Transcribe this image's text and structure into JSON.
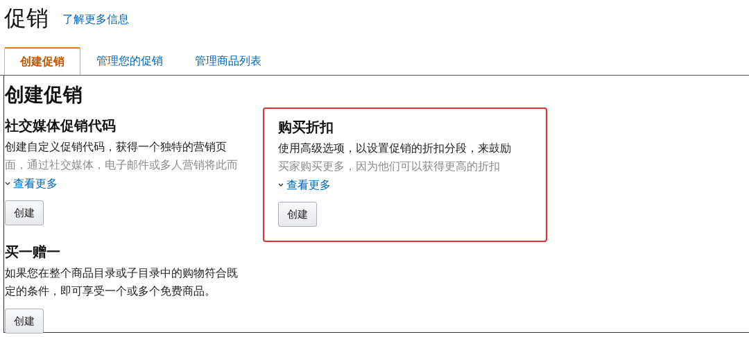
{
  "page": {
    "title": "促销",
    "link": "了解更多信息"
  },
  "tabs": [
    {
      "label": "创建促销",
      "selected": true
    },
    {
      "label": "管理您的促销",
      "selected": false
    },
    {
      "label": "管理商品列表",
      "selected": false
    }
  ],
  "section_title": "创建促销",
  "cards": [
    {
      "title": "社交媒体促销代码",
      "highlighted": false,
      "expanded": false,
      "lines": [
        "创建自定义促销代码，获得一个独特的营销页",
        "面，通过社交媒体，电子邮件或多人营销将此而"
      ],
      "more": "查看更多",
      "button": "创建"
    },
    {
      "title": "购买折扣",
      "highlighted": true,
      "expanded": false,
      "lines": [
        "使用高级选项，以设置促销的折扣分段，来鼓励",
        "买家购买更多，因为他们可以获得更高的折扣"
      ],
      "more": "查看更多",
      "button": "创建"
    },
    {
      "title": "买一赠一",
      "highlighted": false,
      "expanded": true,
      "lines": [
        "如果您在整个商品目录或子目录中的购物符合既",
        "定的条件，即可享受一个或多个免费商品。"
      ],
      "button": "创建"
    }
  ]
}
